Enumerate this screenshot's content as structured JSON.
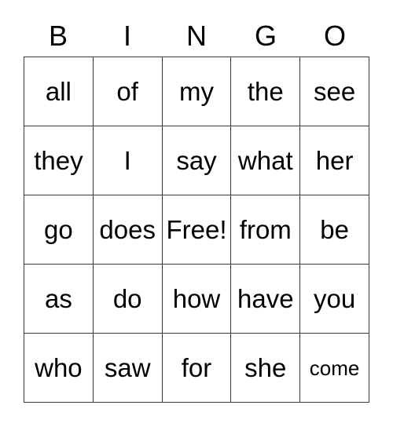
{
  "card": {
    "title_letters": [
      "B",
      "I",
      "N",
      "G",
      "O"
    ],
    "rows": [
      [
        {
          "text": "all",
          "size": "normal"
        },
        {
          "text": "of",
          "size": "normal"
        },
        {
          "text": "my",
          "size": "normal"
        },
        {
          "text": "the",
          "size": "normal"
        },
        {
          "text": "see",
          "size": "normal"
        }
      ],
      [
        {
          "text": "they",
          "size": "normal"
        },
        {
          "text": "I",
          "size": "normal"
        },
        {
          "text": "say",
          "size": "normal"
        },
        {
          "text": "what",
          "size": "normal"
        },
        {
          "text": "her",
          "size": "normal"
        }
      ],
      [
        {
          "text": "go",
          "size": "normal"
        },
        {
          "text": "does",
          "size": "normal"
        },
        {
          "text": "Free!",
          "size": "normal"
        },
        {
          "text": "from",
          "size": "normal"
        },
        {
          "text": "be",
          "size": "normal"
        }
      ],
      [
        {
          "text": "as",
          "size": "normal"
        },
        {
          "text": "do",
          "size": "normal"
        },
        {
          "text": "how",
          "size": "normal"
        },
        {
          "text": "have",
          "size": "normal"
        },
        {
          "text": "you",
          "size": "normal"
        }
      ],
      [
        {
          "text": "who",
          "size": "normal"
        },
        {
          "text": "saw",
          "size": "normal"
        },
        {
          "text": "for",
          "size": "normal"
        },
        {
          "text": "she",
          "size": "normal"
        },
        {
          "text": "come",
          "size": "small"
        }
      ]
    ],
    "colors": {
      "background": "#ffffff",
      "border": "#3a3a3a",
      "text": "#000000"
    }
  }
}
